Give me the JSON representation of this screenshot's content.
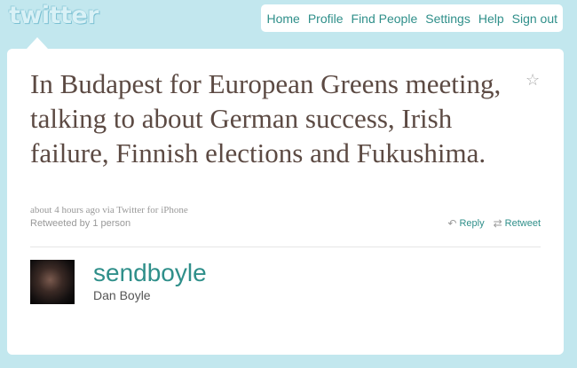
{
  "logo": {
    "text": "twitter"
  },
  "nav": {
    "items": [
      "Home",
      "Profile",
      "Find People",
      "Settings",
      "Help",
      "Sign out"
    ]
  },
  "tweet": {
    "text": "In Budapest for European Greens meeting, talking to about German success, Irish failure, Finnish elections and Fukushima.",
    "meta": "about 4 hours ago via Twitter for iPhone",
    "retweeted_by": "Retweeted by 1 person",
    "reply_label": "Reply",
    "retweet_label": "Retweet"
  },
  "author": {
    "screen_name": "sendboyle",
    "full_name": "Dan Boyle"
  },
  "colors": {
    "background": "#c2e7ee",
    "link": "#2f8f8a",
    "tweet_text": "#5c4a43"
  },
  "icons": {
    "favorite": "star-icon",
    "reply": "reply-arrow-icon",
    "retweet": "retweet-icon"
  }
}
